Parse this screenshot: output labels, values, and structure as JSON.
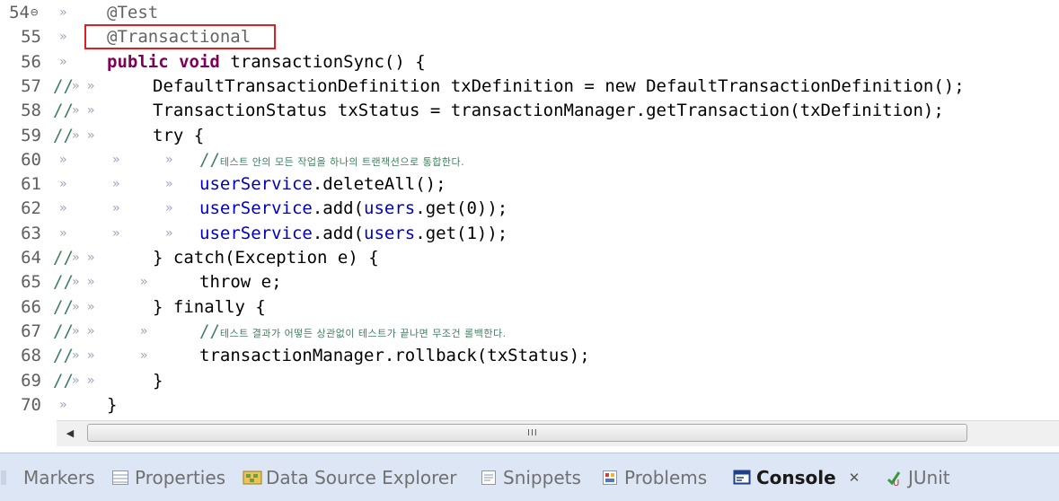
{
  "editor": {
    "lines": [
      {
        "num": "54",
        "fold": "⊖",
        "marks": "»",
        "code": [
          {
            "t": "@Test",
            "c": "ann"
          }
        ]
      },
      {
        "num": "55",
        "marks": "»",
        "code": [
          {
            "t": "@Transactional",
            "c": "ann"
          }
        ]
      },
      {
        "num": "56",
        "marks": "»",
        "code": [
          {
            "t": "public",
            "c": "kw"
          },
          {
            "t": " ",
            "c": "dot"
          },
          {
            "t": "void",
            "c": "kw"
          },
          {
            "t": " ",
            "c": "dot"
          },
          {
            "t": "transactionSync() {",
            "c": "plain"
          }
        ]
      },
      {
        "num": "57",
        "comment": "//",
        "marks": "» »",
        "code": [
          {
            "t": "DefaultTransactionDefinition txDefinition = new DefaultTransactionDefinition();",
            "c": "plain"
          }
        ]
      },
      {
        "num": "58",
        "comment": "//",
        "marks": "» »",
        "code": [
          {
            "t": "TransactionStatus txStatus = transactionManager.getTransaction(txDefinition);",
            "c": "plain"
          }
        ]
      },
      {
        "num": "59",
        "comment": "//",
        "marks": "» »",
        "code": [
          {
            "t": "try {",
            "c": "plain"
          }
        ]
      },
      {
        "num": "60",
        "marks": "»      »      »",
        "code": [
          {
            "t": "//",
            "c": "cm"
          },
          {
            "t": "테스트 안의 모든 작업을 하나의 트랜잭션으로 통합한다.",
            "c": "ko"
          }
        ]
      },
      {
        "num": "61",
        "marks": "»      »      »",
        "code": [
          {
            "t": "userService",
            "c": "fld"
          },
          {
            "t": ".deleteAll();",
            "c": "plain"
          }
        ]
      },
      {
        "num": "62",
        "marks": "»      »      »",
        "code": [
          {
            "t": "userService",
            "c": "fld"
          },
          {
            "t": ".add(",
            "c": "plain"
          },
          {
            "t": "users",
            "c": "fld"
          },
          {
            "t": ".get(0));",
            "c": "plain"
          }
        ]
      },
      {
        "num": "63",
        "marks": "»      »      »",
        "code": [
          {
            "t": "userService",
            "c": "fld"
          },
          {
            "t": ".add(",
            "c": "plain"
          },
          {
            "t": "users",
            "c": "fld"
          },
          {
            "t": ".get(1));",
            "c": "plain"
          }
        ]
      },
      {
        "num": "64",
        "comment": "//",
        "marks": "» »",
        "code": [
          {
            "t": "} catch(Exception e) {",
            "c": "plain"
          }
        ]
      },
      {
        "num": "65",
        "comment": "//",
        "marks": "» »      »",
        "code": [
          {
            "t": "throw e;",
            "c": "plain"
          }
        ]
      },
      {
        "num": "66",
        "comment": "//",
        "marks": "» »",
        "code": [
          {
            "t": "} finally {",
            "c": "plain"
          }
        ]
      },
      {
        "num": "67",
        "comment": "//",
        "marks": "» »      »",
        "code": [
          {
            "t": "//",
            "c": "cm"
          },
          {
            "t": "테스트 결과가 어떻든 상관없이 테스트가 끝나면 무조건 롤백한다.",
            "c": "ko"
          }
        ]
      },
      {
        "num": "68",
        "comment": "//",
        "marks": "» »      »",
        "code": [
          {
            "t": "transactionManager.rollback(txStatus);",
            "c": "plain"
          }
        ]
      },
      {
        "num": "69",
        "comment": "//",
        "marks": "» »",
        "code": [
          {
            "t": "}",
            "c": "plain"
          }
        ]
      },
      {
        "num": "70",
        "marks": "»",
        "code": [
          {
            "t": "}",
            "c": "plain"
          }
        ]
      }
    ]
  },
  "scrollbar": {
    "left_arrow": "◀",
    "grip": "III"
  },
  "tabs": [
    {
      "label": "Markers",
      "icon": "markers-icon"
    },
    {
      "label": "Properties",
      "icon": "properties-icon"
    },
    {
      "label": "Data Source Explorer",
      "icon": "data-source-icon"
    },
    {
      "label": "Snippets",
      "icon": "snippets-icon"
    },
    {
      "label": "Problems",
      "icon": "problems-icon"
    },
    {
      "label": "Console",
      "icon": "console-icon",
      "active": true,
      "close": "✕"
    },
    {
      "label": "JUnit",
      "icon": "junit-icon"
    }
  ],
  "colors": {
    "highlight_box": "#e02020",
    "tabbar_bg": "#dde6f4",
    "keyword": "#7f0055",
    "field": "#0000c0"
  }
}
